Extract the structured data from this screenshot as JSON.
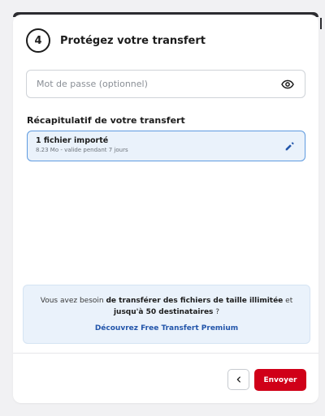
{
  "step": {
    "number": "4",
    "title": "Protégez votre transfert"
  },
  "password": {
    "placeholder": "Mot de passe (optionnel)",
    "value": "",
    "toggle_icon": "eye-icon"
  },
  "summary": {
    "label": "Récapitulatif de votre transfert",
    "file_title": "1 fichier importé",
    "file_details": "8.23 Mo - valide pendant 7 jours",
    "edit_icon": "pencil-icon"
  },
  "promo": {
    "text_before": "Vous avez besoin ",
    "text_bold_1": "de transférer des fichiers de taille illimitée",
    "text_middle": " et ",
    "text_bold_2": "jusqu'à 50 destinataires",
    "text_after": " ?",
    "link": "Découvrez Free Transfert Premium"
  },
  "footer": {
    "back_icon": "chevron-left-icon",
    "send_label": "Envoyer"
  },
  "colors": {
    "accent_red": "#d00018",
    "link_blue": "#2255aa",
    "highlight_bg": "#eaf2fb",
    "highlight_border": "#5f9be0"
  }
}
